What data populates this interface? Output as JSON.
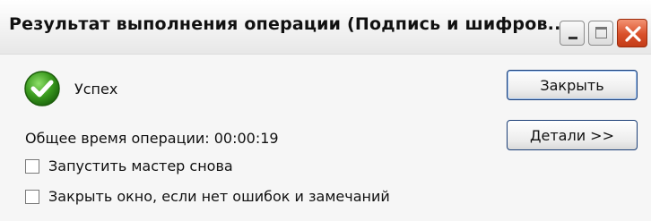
{
  "window": {
    "title": "Результат выполнения операции (Подпись и шифров...",
    "controls": {
      "minimize_icon": "minimize-icon",
      "maximize_icon": "maximize-icon",
      "close_icon": "close-icon"
    }
  },
  "result": {
    "status_icon": "success-check-icon",
    "status_text": "Успех",
    "operation_time": "Общее время операции: 00:00:19"
  },
  "options": [
    {
      "label": "Запустить мастер снова",
      "checked": false
    },
    {
      "label": "Закрыть окно, если нет ошибок и замечаний",
      "checked": false
    }
  ],
  "buttons": {
    "close_label": "Закрыть",
    "details_label": "Детали >>"
  },
  "colors": {
    "success_green": "#3a9a1e",
    "close_red": "#d9502a",
    "button_border": "#1c3f77"
  }
}
